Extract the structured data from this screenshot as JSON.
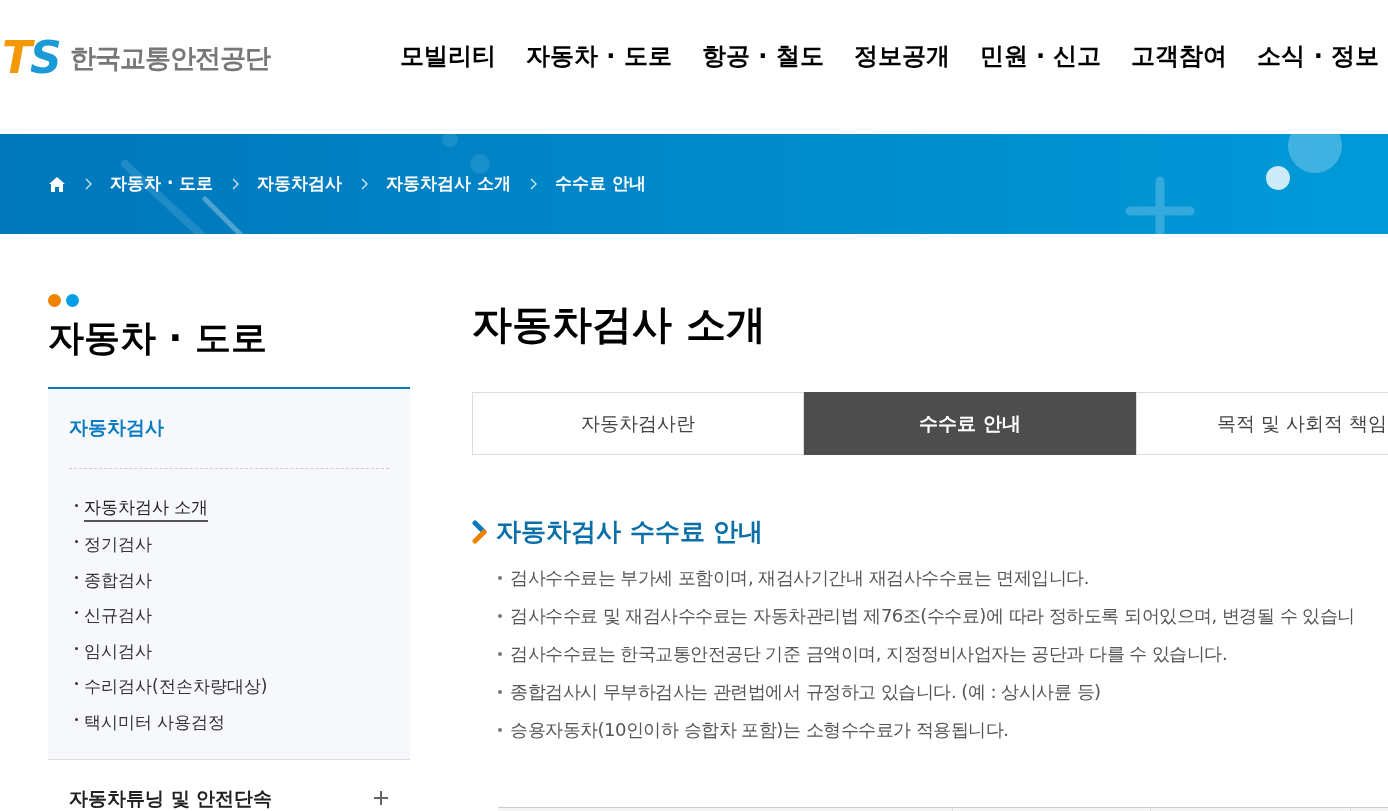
{
  "header": {
    "logo_mark": "TS",
    "logo_text": "한국교통안전공단",
    "nav": [
      "모빌리티",
      "자동차 · 도로",
      "항공 · 철도",
      "정보공개",
      "민원 · 신고",
      "고객참여",
      "소식 · 정보"
    ]
  },
  "breadcrumb": [
    "자동차 · 도로",
    "자동차검사",
    "자동차검사 소개",
    "수수료 안내"
  ],
  "sidebar": {
    "title": "자동차 · 도로",
    "groups": [
      {
        "label": "자동차검사",
        "expanded": true,
        "children": [
          {
            "label": "자동차검사 소개",
            "selected": true
          },
          {
            "label": "정기검사",
            "selected": false
          },
          {
            "label": "종합검사",
            "selected": false
          },
          {
            "label": "신규검사",
            "selected": false
          },
          {
            "label": "임시검사",
            "selected": false
          },
          {
            "label": "수리검사(전손차량대상)",
            "selected": false
          },
          {
            "label": "택시미터 사용검정",
            "selected": false
          }
        ]
      },
      {
        "label": "자동차튜닝 및 안전단속",
        "expanded": false
      }
    ]
  },
  "page_title": "자동차검사 소개",
  "tabs": [
    {
      "label": "자동차검사란",
      "selected": false
    },
    {
      "label": "수수료 안내",
      "selected": true
    },
    {
      "label": "목적 및 사회적 책임",
      "selected": false
    }
  ],
  "section": {
    "heading": "자동차검사 수수료 안내",
    "notes": [
      "검사수수료는 부가세 포함이며, 재검사기간내 재검사수수료는 면제입니다.",
      "검사수수료 및 재검사수수료는 자동차관리법 제76조(수수료)에 따라 정하도록 되어있으며, 변경될 수 있습니",
      "검사수수료는 한국교통안전공단 기준 금액이며, 지정정비사업자는 공단과 다를 수 있습니다.",
      "종합검사시 무부하검사는 관련법에서 규정하고 있습니다. (예 : 상시사륜 등)",
      "승용자동차(10인이하 승합차 포함)는 소형수수료가 적용됩니다."
    ]
  }
}
